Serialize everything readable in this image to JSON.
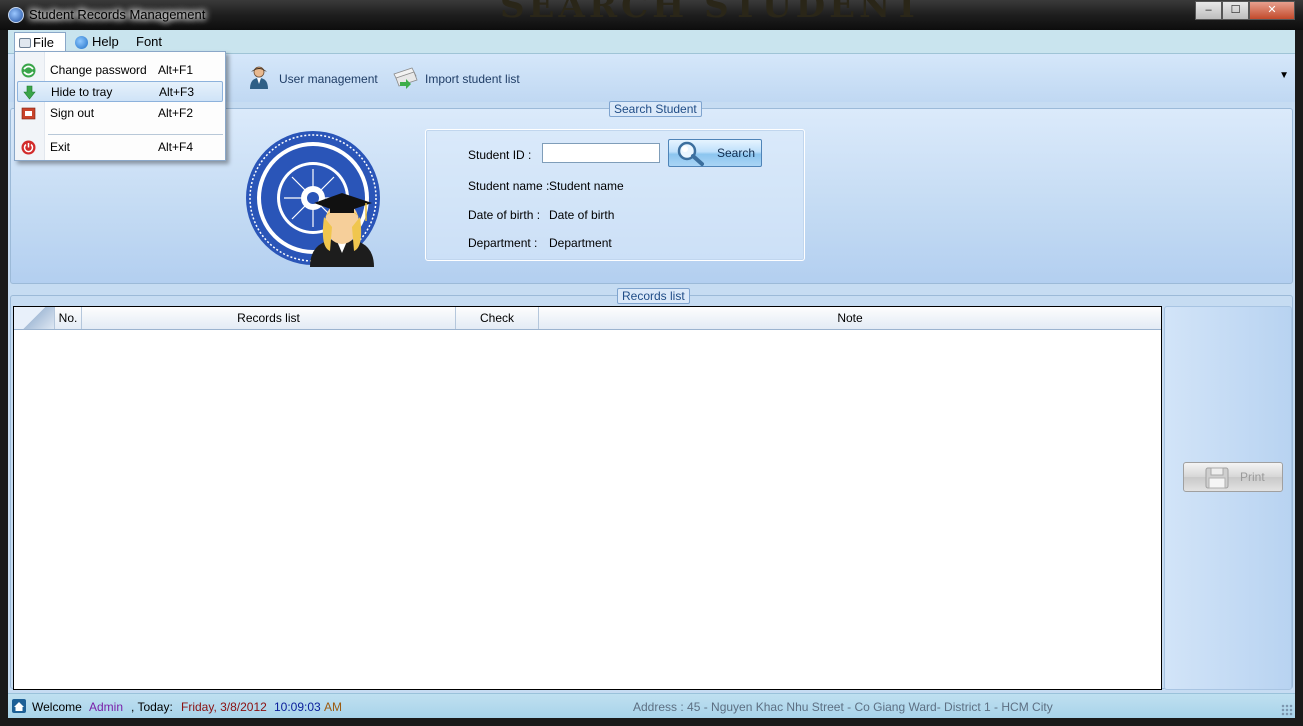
{
  "window": {
    "title": "Student Records Management",
    "controls": {
      "minimize": "‒",
      "maximize": "☐",
      "close": "✕"
    }
  },
  "menubar": {
    "items": [
      {
        "label": "File",
        "icon": "file-menu-icon",
        "active": true
      },
      {
        "label": "Help",
        "icon": "help-icon"
      },
      {
        "label": "Font"
      }
    ]
  },
  "file_menu": {
    "items": [
      {
        "label": "Change password",
        "shortcut": "Alt+F1",
        "icon": "refresh-globe-icon"
      },
      {
        "label": "Hide to tray",
        "shortcut": "Alt+F3",
        "icon": "down-arrow-icon",
        "highlighted": true
      },
      {
        "label": "Sign out",
        "shortcut": "Alt+F2",
        "icon": "sign-out-icon"
      },
      {
        "label": "Exit",
        "shortcut": "Alt+F4",
        "icon": "power-icon"
      }
    ]
  },
  "toolbar": {
    "user_management": "User management",
    "import_student_list": "Import student list",
    "overflow": "▼"
  },
  "search": {
    "group_title": "Search Student",
    "student_id_label": "Student ID :",
    "student_id_value": "",
    "search_button": "Search",
    "student_name_label": "Student name :",
    "student_name_value": "Student name",
    "dob_label": "Date of birth :",
    "dob_value": "Date of birth",
    "department_label": "Department :",
    "department_value": "Department"
  },
  "records": {
    "group_title": "Records list",
    "columns": [
      "No.",
      "Records list",
      "Check",
      "Note"
    ],
    "rows": [],
    "print_button": "Print"
  },
  "status": {
    "welcome": "Welcome",
    "user": "Admin",
    "today_label": ", Today:",
    "date": "Friday, 3/8/2012",
    "time": "10:09:03",
    "ampm": "AM",
    "address": "Address : 45 - Nguyen Khac Nhu Street - Co Giang Ward- District 1 - HCM City"
  },
  "colors": {
    "accent": "#1f4c86",
    "admin_text": "#7a1fa8",
    "date_text": "#8b1010",
    "time_text": "#0a1e9a"
  }
}
